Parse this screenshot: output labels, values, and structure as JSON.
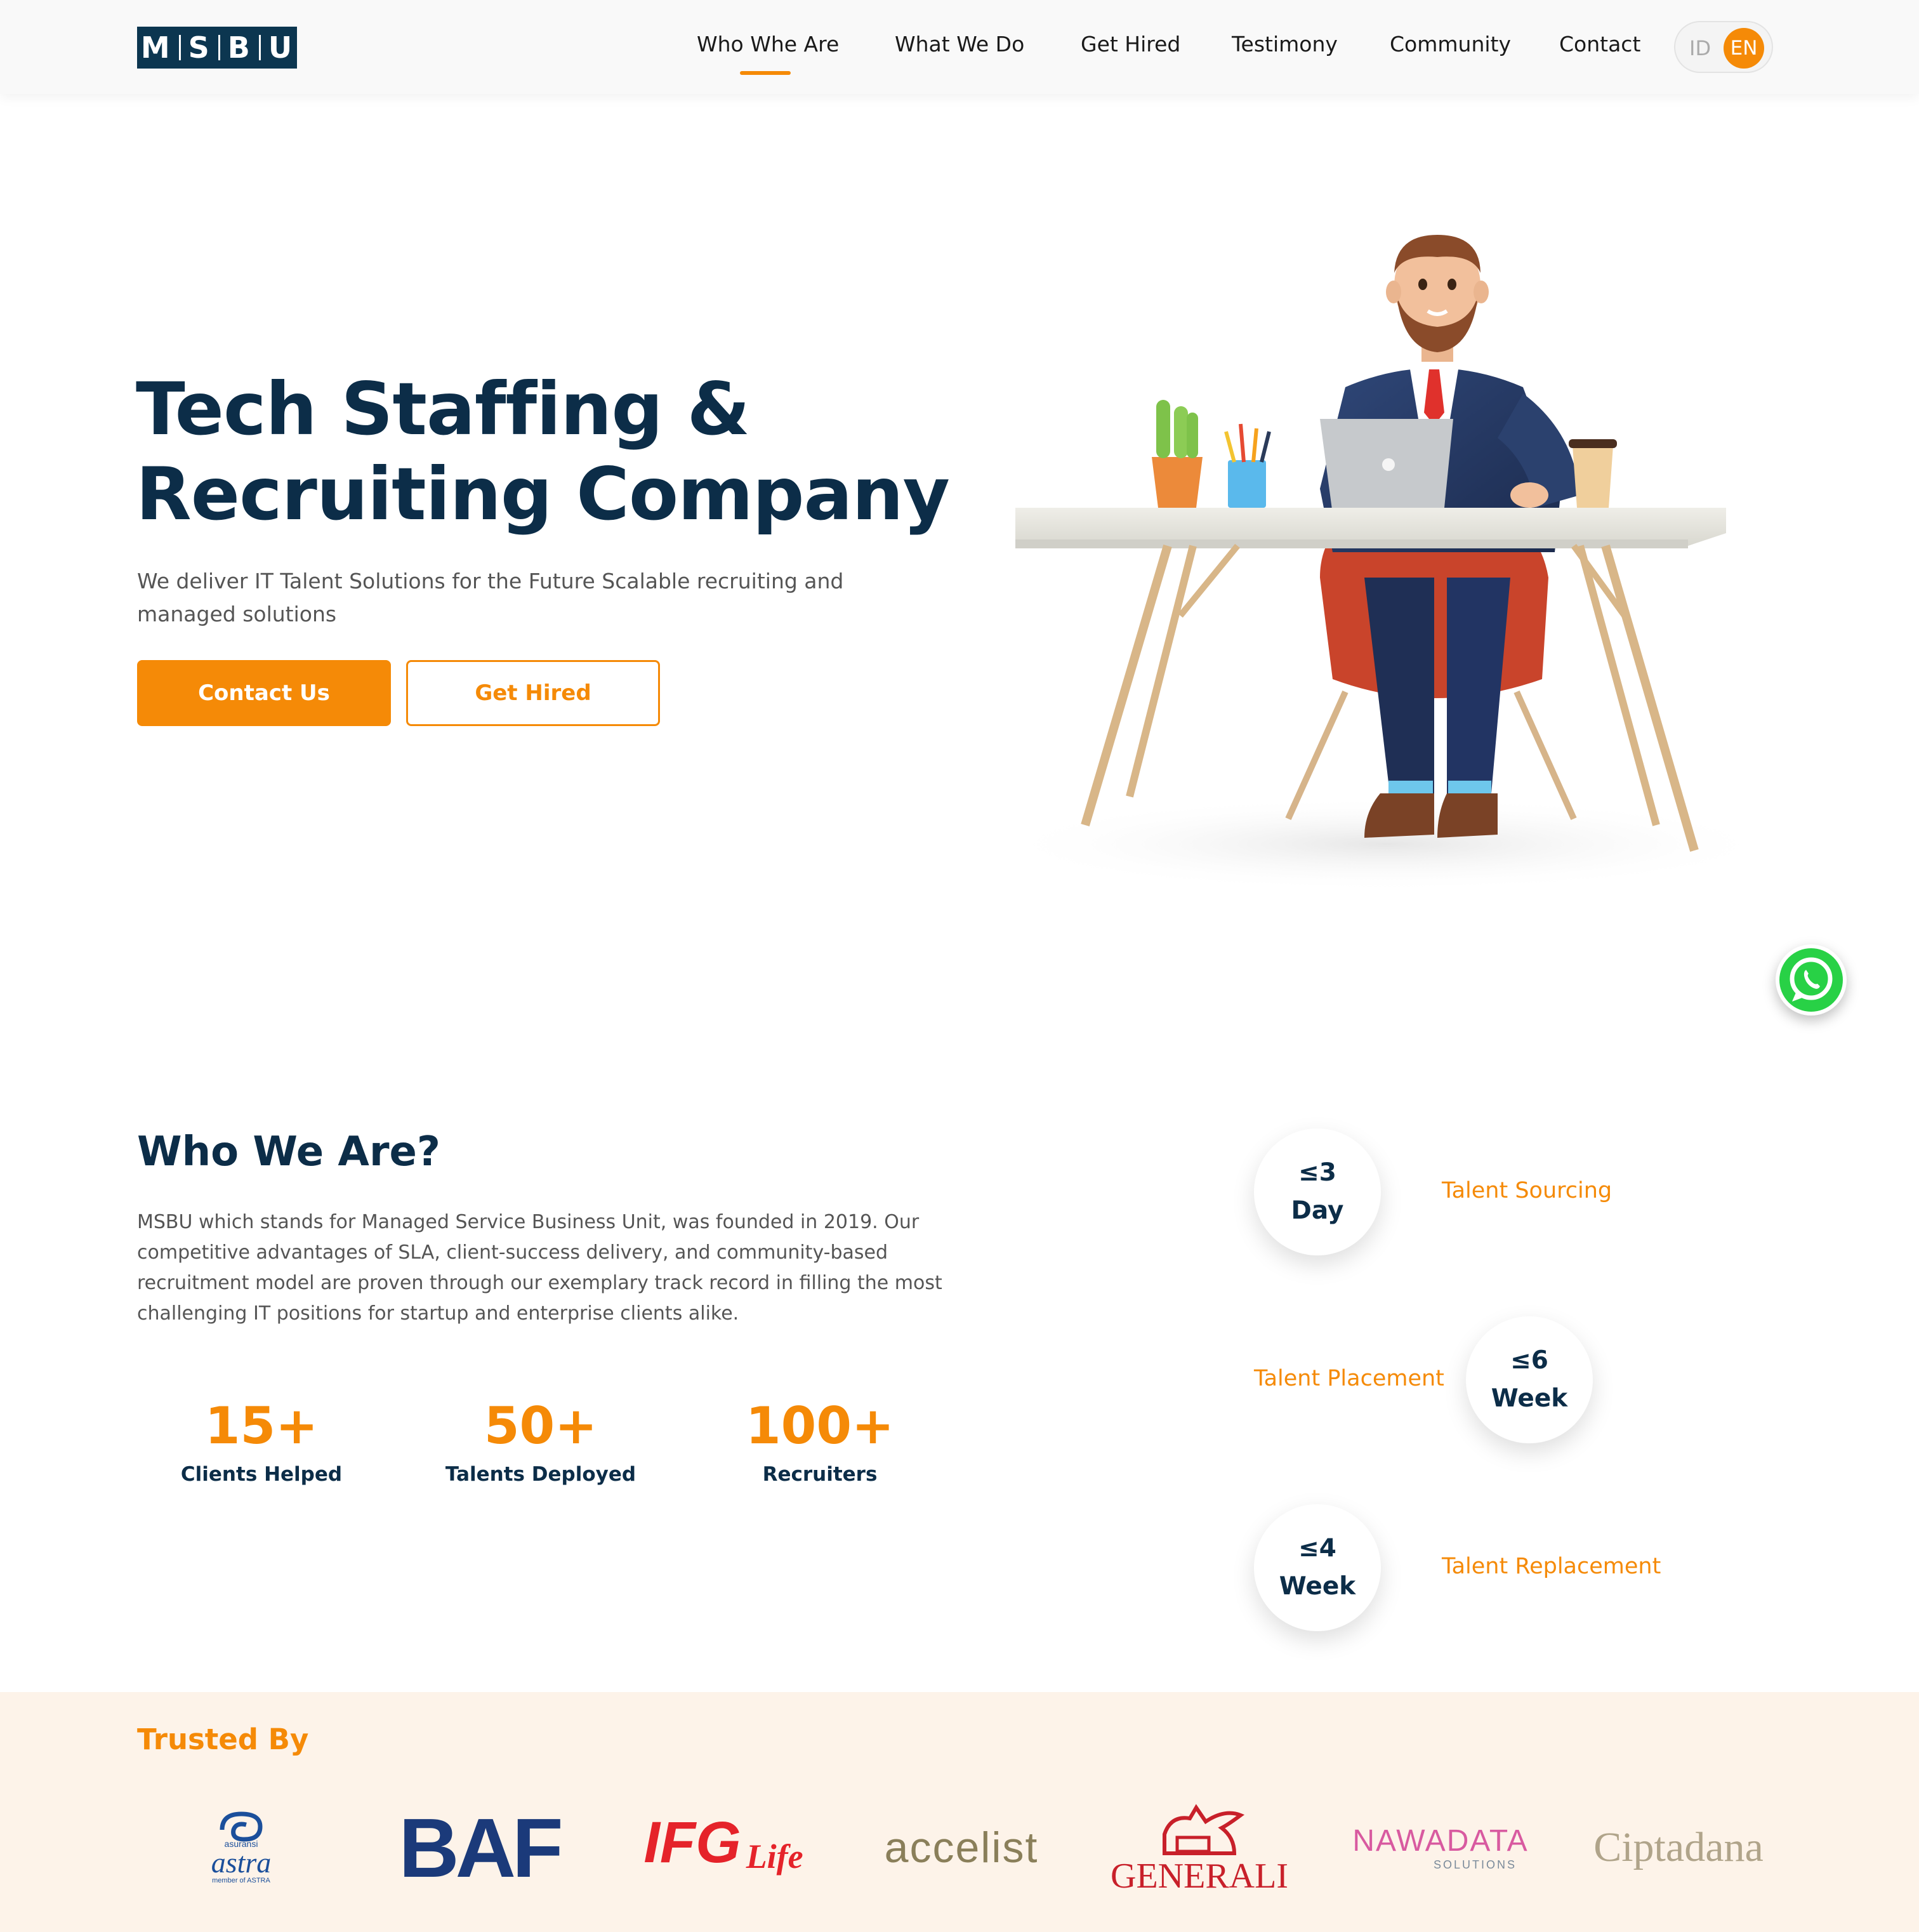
{
  "header": {
    "logo_letters": [
      "M",
      "S",
      "B",
      "U"
    ],
    "nav": [
      {
        "label": "Who Whe Are",
        "active": true
      },
      {
        "label": "What We Do"
      },
      {
        "label": "Get Hired"
      },
      {
        "label": "Testimony"
      },
      {
        "label": "Community"
      },
      {
        "label": "Contact"
      }
    ],
    "lang": {
      "id_label": "ID",
      "en_label": "EN",
      "selected": "EN"
    }
  },
  "hero": {
    "title_line1": "Tech Staffing &",
    "title_line2": "Recruiting Company",
    "subtitle": "We deliver IT Talent Solutions for the Future Scalable recruiting and managed solutions",
    "primary_button": "Contact Us",
    "secondary_button": "Get Hired"
  },
  "who": {
    "title": "Who We Are?",
    "text": "MSBU which stands for Managed Service Business Unit, was founded in 2019. Our competitive advantages of SLA, client-success delivery, and community-based recruitment model are proven through our exemplary track record in filling the most challenging IT positions for startup and enterprise clients alike.",
    "stats": [
      {
        "value": "15+",
        "label": "Clients Helped"
      },
      {
        "value": "50+",
        "label": "Talents Deployed"
      },
      {
        "value": "100+",
        "label": "Recruiters"
      }
    ],
    "sla": [
      {
        "line1": "≤3",
        "line2": "Day",
        "label": "Talent Sourcing"
      },
      {
        "line1": "≤6",
        "line2": "Week",
        "label": "Talent Placement"
      },
      {
        "line1": "≤4",
        "line2": "Week",
        "label": "Talent Replacement"
      }
    ]
  },
  "trusted": {
    "title": "Trusted By",
    "logos": {
      "astra": {
        "small": "asuransi",
        "main": "astra",
        "tag": "member of ASTRA"
      },
      "baf": "BAF",
      "ifg": {
        "main": "IFG",
        "suffix": "Life"
      },
      "accelist": "accelist",
      "generali": "GENERALI",
      "nawadata": {
        "main": "NAWADATA",
        "sub": "SOLUTIONS"
      },
      "ciptadana": "Ciptadana"
    }
  },
  "colors": {
    "accent": "#f58a07",
    "navy": "#0c2d48",
    "trusted_bg": "#fdf3e9",
    "whatsapp": "#28d146"
  },
  "icons": {
    "whatsapp": "whatsapp-icon"
  }
}
